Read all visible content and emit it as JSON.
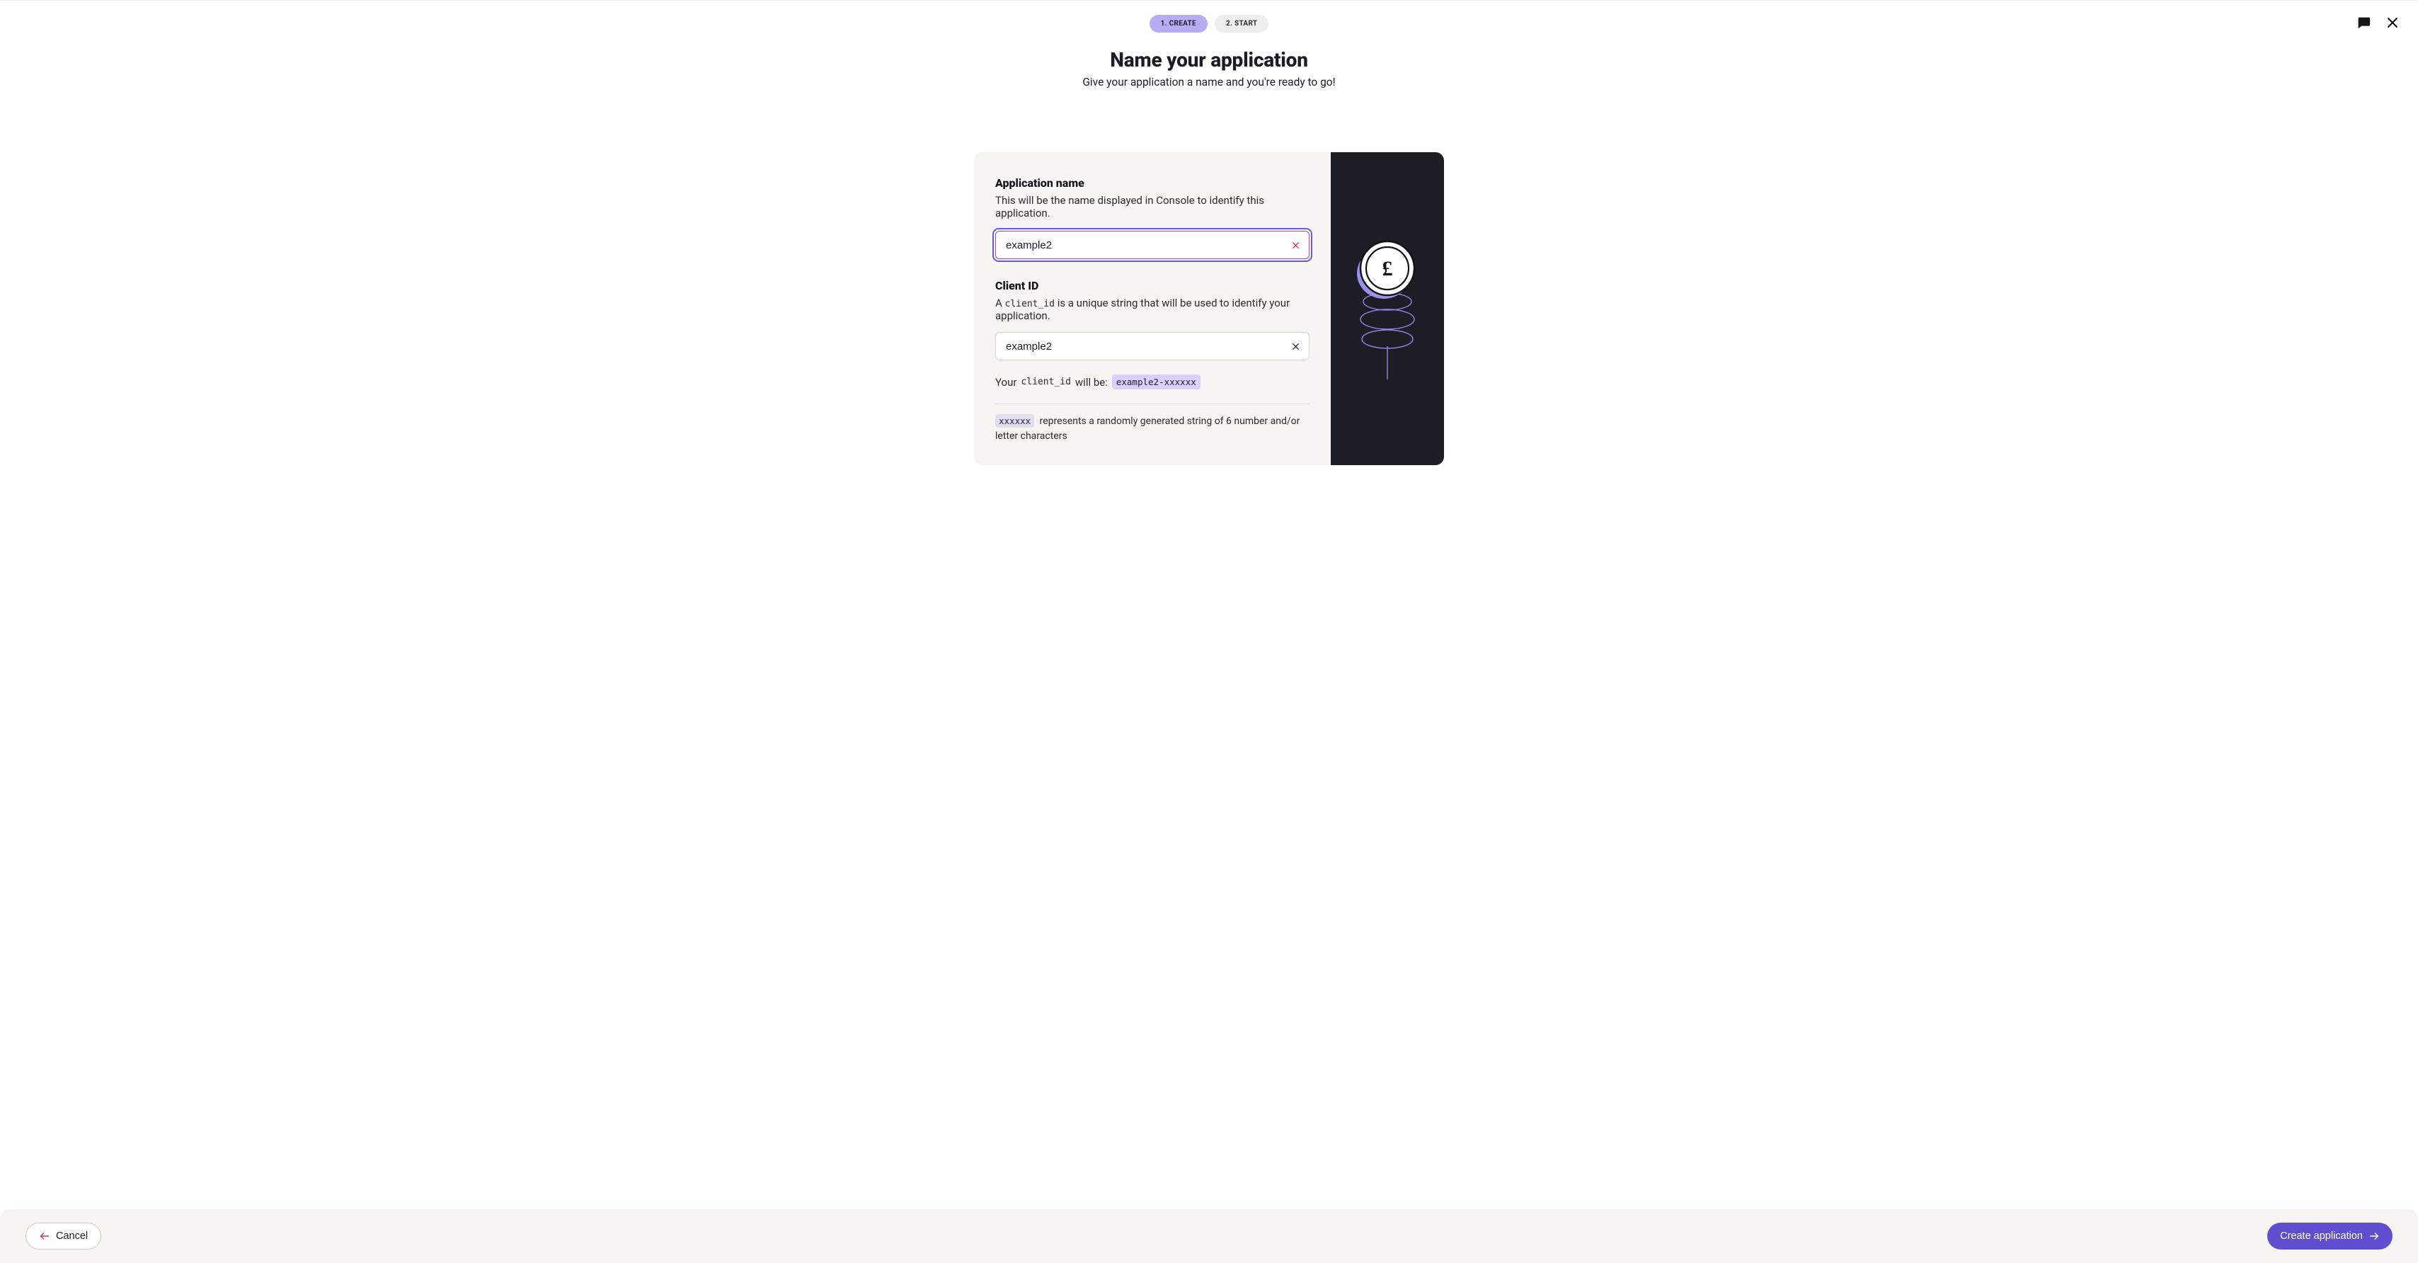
{
  "steps": {
    "create": "1. CREATE",
    "start": "2. START"
  },
  "header": {
    "title": "Name your application",
    "subtitle": "Give your application a name and you're ready to go!"
  },
  "form": {
    "appName": {
      "label": "Application name",
      "desc": "This will be the name displayed in Console to identify this application.",
      "value": "example2"
    },
    "clientId": {
      "label": "Client ID",
      "desc_prefix": "A ",
      "desc_code": "client_id",
      "desc_suffix": " is a unique string that will be used to identify your application.",
      "value": "example2",
      "hint_prefix": "Your ",
      "hint_code": "client_id",
      "hint_mid": " will be: ",
      "hint_chip": "example2-xxxxxx",
      "note_chip": "xxxxxx",
      "note_text": " represents a randomly generated string of 6 number and/or letter characters"
    }
  },
  "footer": {
    "cancel": "Cancel",
    "create": "Create application"
  },
  "icons": {
    "chat": "chat-icon",
    "close": "close-icon",
    "arrowLeft": "arrow-left-icon",
    "arrowRight": "arrow-right-icon",
    "coin": "coin-spring-illustration"
  },
  "colors": {
    "primary": "#5e4fd0",
    "accentPink": "#dc3069",
    "paper": "#f7f5f2",
    "darkPanel": "#1d1d26"
  }
}
